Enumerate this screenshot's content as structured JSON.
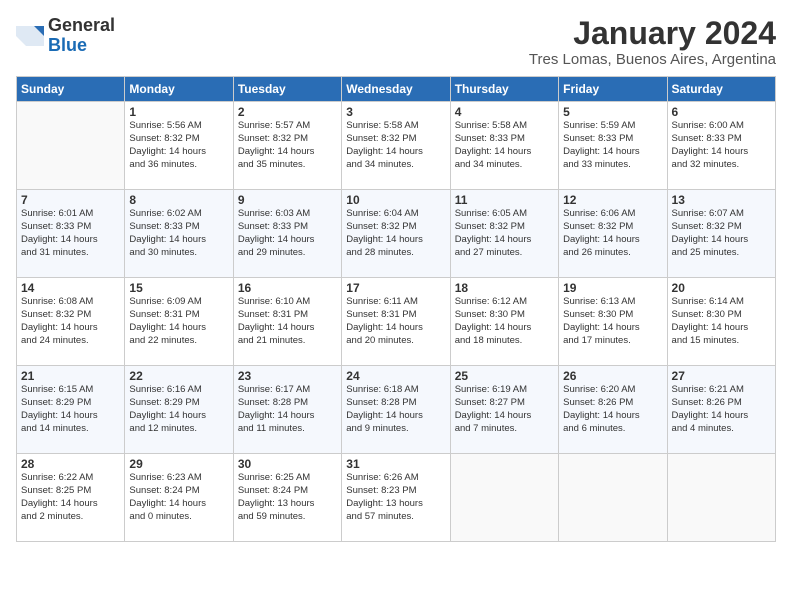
{
  "logo": {
    "general": "General",
    "blue": "Blue"
  },
  "title": "January 2024",
  "location": "Tres Lomas, Buenos Aires, Argentina",
  "days_of_week": [
    "Sunday",
    "Monday",
    "Tuesday",
    "Wednesday",
    "Thursday",
    "Friday",
    "Saturday"
  ],
  "weeks": [
    [
      {
        "day": "",
        "sunrise": "",
        "sunset": "",
        "daylight": "",
        "empty": true
      },
      {
        "day": "1",
        "sunrise": "Sunrise: 5:56 AM",
        "sunset": "Sunset: 8:32 PM",
        "daylight": "Daylight: 14 hours and 36 minutes."
      },
      {
        "day": "2",
        "sunrise": "Sunrise: 5:57 AM",
        "sunset": "Sunset: 8:32 PM",
        "daylight": "Daylight: 14 hours and 35 minutes."
      },
      {
        "day": "3",
        "sunrise": "Sunrise: 5:58 AM",
        "sunset": "Sunset: 8:32 PM",
        "daylight": "Daylight: 14 hours and 34 minutes."
      },
      {
        "day": "4",
        "sunrise": "Sunrise: 5:58 AM",
        "sunset": "Sunset: 8:33 PM",
        "daylight": "Daylight: 14 hours and 34 minutes."
      },
      {
        "day": "5",
        "sunrise": "Sunrise: 5:59 AM",
        "sunset": "Sunset: 8:33 PM",
        "daylight": "Daylight: 14 hours and 33 minutes."
      },
      {
        "day": "6",
        "sunrise": "Sunrise: 6:00 AM",
        "sunset": "Sunset: 8:33 PM",
        "daylight": "Daylight: 14 hours and 32 minutes."
      }
    ],
    [
      {
        "day": "7",
        "sunrise": "Sunrise: 6:01 AM",
        "sunset": "Sunset: 8:33 PM",
        "daylight": "Daylight: 14 hours and 31 minutes."
      },
      {
        "day": "8",
        "sunrise": "Sunrise: 6:02 AM",
        "sunset": "Sunset: 8:33 PM",
        "daylight": "Daylight: 14 hours and 30 minutes."
      },
      {
        "day": "9",
        "sunrise": "Sunrise: 6:03 AM",
        "sunset": "Sunset: 8:33 PM",
        "daylight": "Daylight: 14 hours and 29 minutes."
      },
      {
        "day": "10",
        "sunrise": "Sunrise: 6:04 AM",
        "sunset": "Sunset: 8:32 PM",
        "daylight": "Daylight: 14 hours and 28 minutes."
      },
      {
        "day": "11",
        "sunrise": "Sunrise: 6:05 AM",
        "sunset": "Sunset: 8:32 PM",
        "daylight": "Daylight: 14 hours and 27 minutes."
      },
      {
        "day": "12",
        "sunrise": "Sunrise: 6:06 AM",
        "sunset": "Sunset: 8:32 PM",
        "daylight": "Daylight: 14 hours and 26 minutes."
      },
      {
        "day": "13",
        "sunrise": "Sunrise: 6:07 AM",
        "sunset": "Sunset: 8:32 PM",
        "daylight": "Daylight: 14 hours and 25 minutes."
      }
    ],
    [
      {
        "day": "14",
        "sunrise": "Sunrise: 6:08 AM",
        "sunset": "Sunset: 8:32 PM",
        "daylight": "Daylight: 14 hours and 24 minutes."
      },
      {
        "day": "15",
        "sunrise": "Sunrise: 6:09 AM",
        "sunset": "Sunset: 8:31 PM",
        "daylight": "Daylight: 14 hours and 22 minutes."
      },
      {
        "day": "16",
        "sunrise": "Sunrise: 6:10 AM",
        "sunset": "Sunset: 8:31 PM",
        "daylight": "Daylight: 14 hours and 21 minutes."
      },
      {
        "day": "17",
        "sunrise": "Sunrise: 6:11 AM",
        "sunset": "Sunset: 8:31 PM",
        "daylight": "Daylight: 14 hours and 20 minutes."
      },
      {
        "day": "18",
        "sunrise": "Sunrise: 6:12 AM",
        "sunset": "Sunset: 8:30 PM",
        "daylight": "Daylight: 14 hours and 18 minutes."
      },
      {
        "day": "19",
        "sunrise": "Sunrise: 6:13 AM",
        "sunset": "Sunset: 8:30 PM",
        "daylight": "Daylight: 14 hours and 17 minutes."
      },
      {
        "day": "20",
        "sunrise": "Sunrise: 6:14 AM",
        "sunset": "Sunset: 8:30 PM",
        "daylight": "Daylight: 14 hours and 15 minutes."
      }
    ],
    [
      {
        "day": "21",
        "sunrise": "Sunrise: 6:15 AM",
        "sunset": "Sunset: 8:29 PM",
        "daylight": "Daylight: 14 hours and 14 minutes."
      },
      {
        "day": "22",
        "sunrise": "Sunrise: 6:16 AM",
        "sunset": "Sunset: 8:29 PM",
        "daylight": "Daylight: 14 hours and 12 minutes."
      },
      {
        "day": "23",
        "sunrise": "Sunrise: 6:17 AM",
        "sunset": "Sunset: 8:28 PM",
        "daylight": "Daylight: 14 hours and 11 minutes."
      },
      {
        "day": "24",
        "sunrise": "Sunrise: 6:18 AM",
        "sunset": "Sunset: 8:28 PM",
        "daylight": "Daylight: 14 hours and 9 minutes."
      },
      {
        "day": "25",
        "sunrise": "Sunrise: 6:19 AM",
        "sunset": "Sunset: 8:27 PM",
        "daylight": "Daylight: 14 hours and 7 minutes."
      },
      {
        "day": "26",
        "sunrise": "Sunrise: 6:20 AM",
        "sunset": "Sunset: 8:26 PM",
        "daylight": "Daylight: 14 hours and 6 minutes."
      },
      {
        "day": "27",
        "sunrise": "Sunrise: 6:21 AM",
        "sunset": "Sunset: 8:26 PM",
        "daylight": "Daylight: 14 hours and 4 minutes."
      }
    ],
    [
      {
        "day": "28",
        "sunrise": "Sunrise: 6:22 AM",
        "sunset": "Sunset: 8:25 PM",
        "daylight": "Daylight: 14 hours and 2 minutes."
      },
      {
        "day": "29",
        "sunrise": "Sunrise: 6:23 AM",
        "sunset": "Sunset: 8:24 PM",
        "daylight": "Daylight: 14 hours and 0 minutes."
      },
      {
        "day": "30",
        "sunrise": "Sunrise: 6:25 AM",
        "sunset": "Sunset: 8:24 PM",
        "daylight": "Daylight: 13 hours and 59 minutes."
      },
      {
        "day": "31",
        "sunrise": "Sunrise: 6:26 AM",
        "sunset": "Sunset: 8:23 PM",
        "daylight": "Daylight: 13 hours and 57 minutes."
      },
      {
        "day": "",
        "sunrise": "",
        "sunset": "",
        "daylight": "",
        "empty": true
      },
      {
        "day": "",
        "sunrise": "",
        "sunset": "",
        "daylight": "",
        "empty": true
      },
      {
        "day": "",
        "sunrise": "",
        "sunset": "",
        "daylight": "",
        "empty": true
      }
    ]
  ]
}
